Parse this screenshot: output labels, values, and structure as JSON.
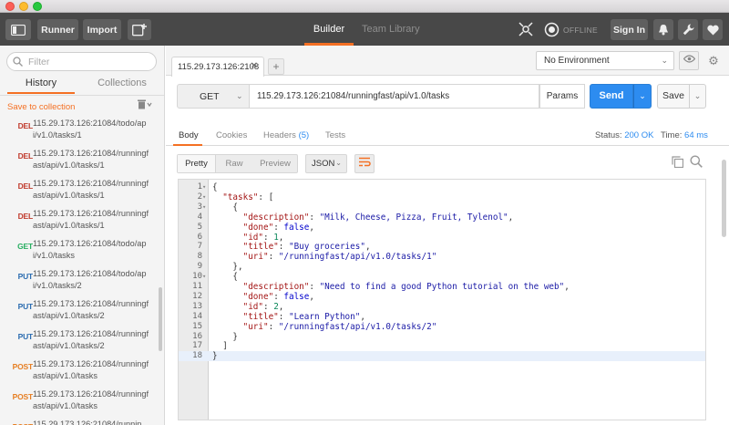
{
  "toolbar": {
    "runner_label": "Runner",
    "import_label": "Import",
    "builder_label": "Builder",
    "team_library_label": "Team Library",
    "offline_label": "OFFLINE",
    "signin_label": "Sign In",
    "accent": "#f47023"
  },
  "sidebar": {
    "filter_placeholder": "Filter",
    "tab_history": "History",
    "tab_collections": "Collections",
    "save_to_collection": "Save to collection",
    "items": [
      {
        "method": "DEL",
        "url": "115.29.173.126:21084/todo/api/v1.0/tasks/1"
      },
      {
        "method": "DEL",
        "url": "115.29.173.126:21084/runningfast/api/v1.0/tasks/1"
      },
      {
        "method": "DEL",
        "url": "115.29.173.126:21084/runningfast/api/v1.0/tasks/1"
      },
      {
        "method": "DEL",
        "url": "115.29.173.126:21084/runningfast/api/v1.0/tasks/1"
      },
      {
        "method": "GET",
        "url": "115.29.173.126:21084/todo/api/v1.0/tasks"
      },
      {
        "method": "PUT",
        "url": "115.29.173.126:21084/todo/api/v1.0/tasks/2"
      },
      {
        "method": "PUT",
        "url": "115.29.173.126:21084/runningfast/api/v1.0/tasks/2"
      },
      {
        "method": "PUT",
        "url": "115.29.173.126:21084/runningfast/api/v1.0/tasks/2"
      },
      {
        "method": "POST",
        "url": "115.29.173.126:21084/runningfast/api/v1.0/tasks"
      },
      {
        "method": "POST",
        "url": "115.29.173.126:21084/runningfast/api/v1.0/tasks"
      },
      {
        "method": "POST",
        "url": "115.29.173.126:21084/runnin"
      }
    ]
  },
  "request": {
    "tab_label": "115.29.173.126:2108",
    "environment": "No Environment",
    "method": "GET",
    "url": "115.29.173.126:21084/runningfast/api/v1.0/tasks",
    "params_label": "Params",
    "send_label": "Send",
    "save_label": "Save"
  },
  "response": {
    "tab_body": "Body",
    "tab_cookies": "Cookies",
    "tab_headers": "Headers",
    "headers_count": "(5)",
    "tab_tests": "Tests",
    "status_label": "Status:",
    "status_value": "200 OK",
    "time_label": "Time:",
    "time_value": "64 ms",
    "view_pretty": "Pretty",
    "view_raw": "Raw",
    "view_preview": "Preview",
    "format": "JSON",
    "body_lines": [
      "{",
      "  \"tasks\": [",
      "    {",
      "      \"description\": \"Milk, Cheese, Pizza, Fruit, Tylenol\",",
      "      \"done\": false,",
      "      \"id\": 1,",
      "      \"title\": \"Buy groceries\",",
      "      \"uri\": \"/runningfast/api/v1.0/tasks/1\"",
      "    },",
      "    {",
      "      \"description\": \"Need to find a good Python tutorial on the web\",",
      "      \"done\": false,",
      "      \"id\": 2,",
      "      \"title\": \"Learn Python\",",
      "      \"uri\": \"/runningfast/api/v1.0/tasks/2\"",
      "    }",
      "  ]",
      "}"
    ],
    "fold_lines": [
      1,
      2,
      3,
      10
    ],
    "highlight_line": 18
  }
}
